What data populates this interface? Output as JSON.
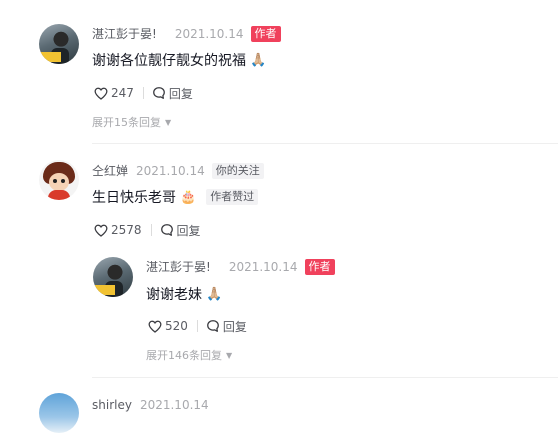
{
  "comments": [
    {
      "username": "湛江彭于晏!",
      "date": "2021.10.14",
      "author_tag": "作者",
      "text": "谢谢各位靓仔靓女的祝福",
      "emoji": "🙏🏼",
      "likes": "247",
      "reply_label": "回复",
      "expand_text": "展开15条回复"
    },
    {
      "username": "仝红婵",
      "date": "2021.10.14",
      "follow_tag": "你的关注",
      "text": "生日快乐老哥",
      "emoji": "🎂",
      "liked_tag": "作者赞过",
      "likes": "2578",
      "reply_label": "回复",
      "reply": {
        "username": "湛江彭于晏!",
        "date": "2021.10.14",
        "author_tag": "作者",
        "text": "谢谢老妹",
        "emoji": "🙏🏼",
        "likes": "520",
        "reply_label": "回复",
        "expand_text": "展开146条回复"
      }
    },
    {
      "username": "shirley",
      "date": "2021.10.14"
    }
  ],
  "icons": {
    "heart": "heart-icon",
    "reply": "comment-bubble-icon",
    "expand": "chevron-down-icon"
  },
  "colors": {
    "author_tag_bg": "#f0415c",
    "primary_text": "#161823",
    "secondary_text": "#5a5c63",
    "muted_text": "#a8a9ad"
  }
}
